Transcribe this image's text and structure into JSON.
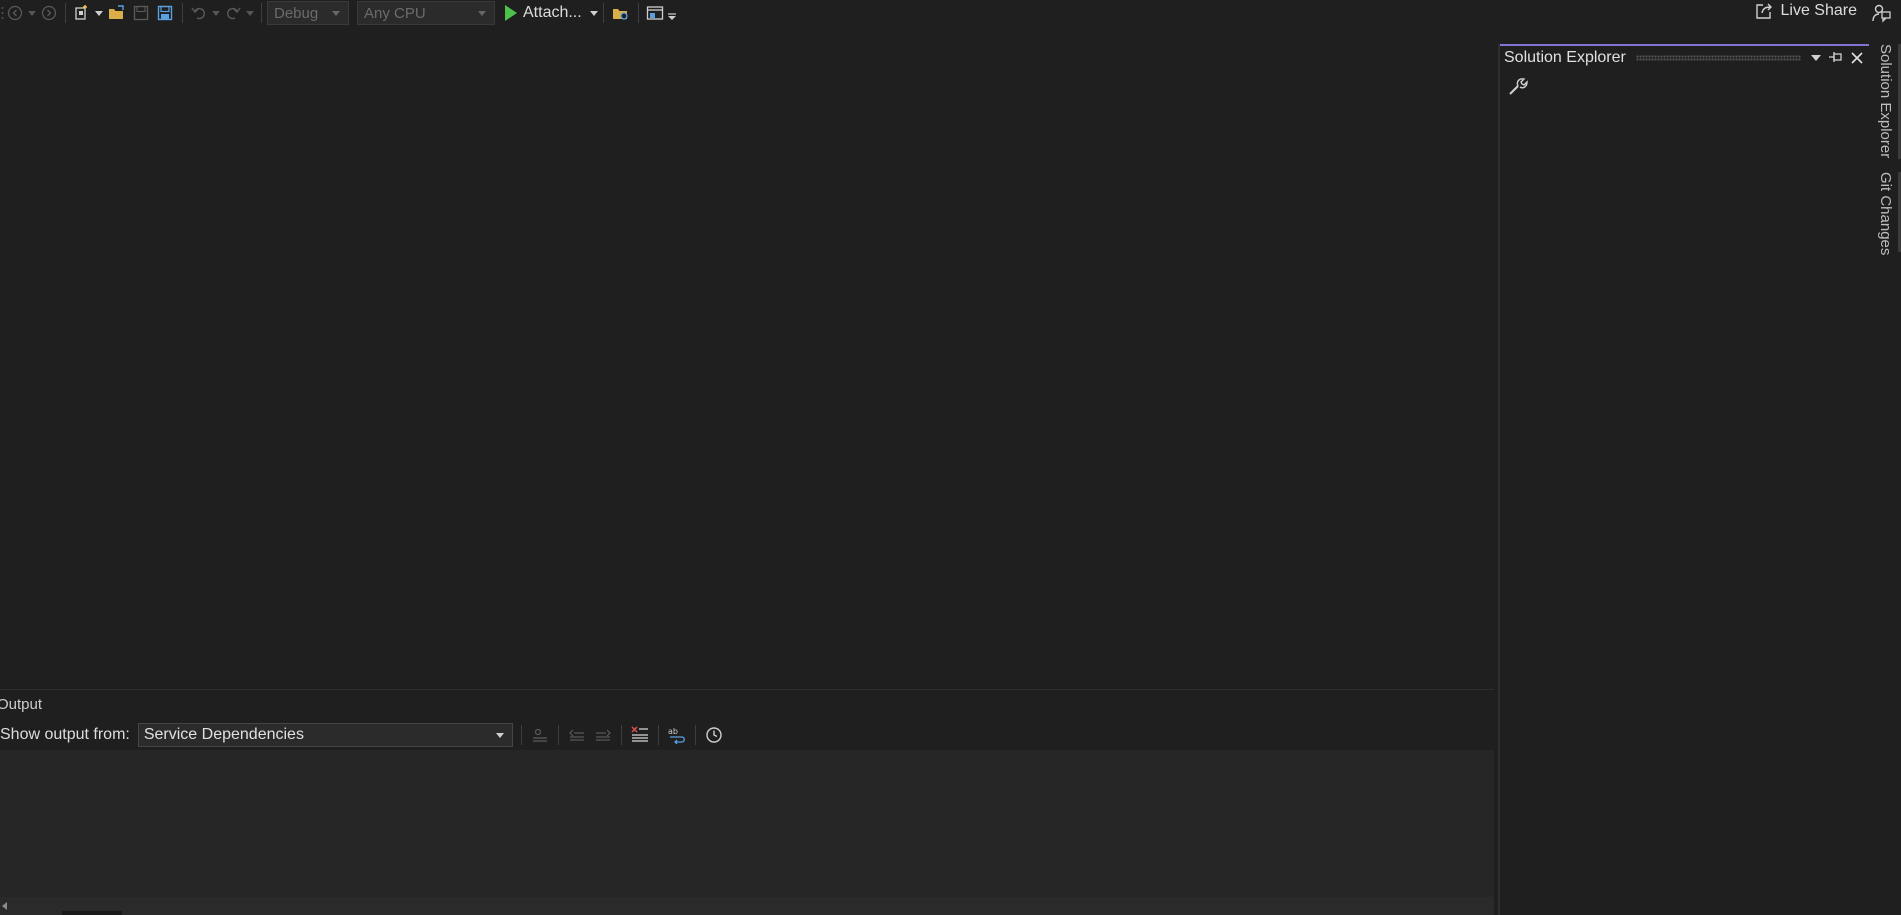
{
  "toolbar": {
    "configuration": "Debug",
    "platform": "Any CPU",
    "start_label": "Attach...",
    "live_share_label": "Live Share"
  },
  "output": {
    "title": "Output",
    "show_from_label": "Show output from:",
    "source_selected": "Service Dependencies"
  },
  "solution_explorer": {
    "title": "Solution Explorer"
  },
  "side_tabs": [
    {
      "label": "Solution Explorer"
    },
    {
      "label": "Git Changes"
    }
  ],
  "icons": {
    "back": "nav-back-icon",
    "forward": "nav-forward-icon",
    "new_project": "new-project-icon",
    "open": "open-folder-icon",
    "save": "save-icon",
    "save_all": "save-all-icon",
    "undo": "undo-icon",
    "redo": "redo-icon",
    "play": "start-icon",
    "live_share": "share-icon",
    "feedback": "feedback-icon",
    "wrench": "wrench-icon"
  },
  "colors": {
    "accent": "#8672d6",
    "play": "#4cc24c",
    "background": "#1f1f1f"
  }
}
